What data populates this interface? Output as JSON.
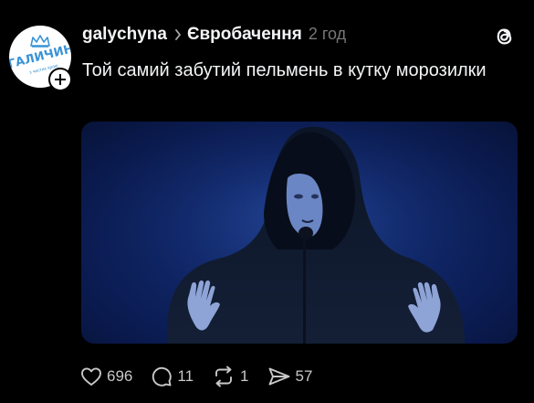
{
  "post": {
    "username": "galychyna",
    "topic": "Євробачення",
    "time": "2 год",
    "text": "Той самий забутий пельмень в кутку морозилки",
    "avatar": {
      "logo_text": "ГАЛИЧИНА",
      "logo_subtext": "з чистих краю"
    }
  },
  "actions": {
    "likes": "696",
    "replies": "11",
    "reposts": "1",
    "shares": "57"
  },
  "icons": {
    "like": "heart-icon",
    "reply": "comment-icon",
    "repost": "repost-icon",
    "share": "send-icon",
    "app": "threads-logo-icon",
    "follow": "plus-icon"
  },
  "colors": {
    "background": "#000000",
    "text": "#f3f5f7",
    "muted": "#777777",
    "logo_blue": "#3a93d6"
  }
}
